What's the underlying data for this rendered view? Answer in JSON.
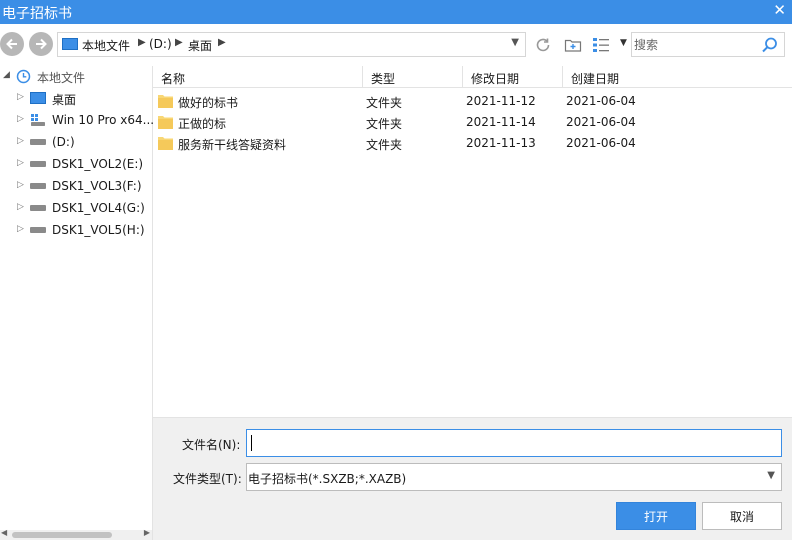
{
  "window": {
    "title": "电子招标书"
  },
  "address": {
    "segments": [
      "本地文件",
      "(D:)",
      "桌面"
    ]
  },
  "search": {
    "placeholder": "搜索"
  },
  "sidebar": {
    "root": "本地文件",
    "items": [
      {
        "label": "桌面",
        "icon": "desktop-icon"
      },
      {
        "label": "Win 10 Pro x64...",
        "icon": "windows-drive-icon"
      },
      {
        "label": "(D:)",
        "icon": "drive-icon"
      },
      {
        "label": "DSK1_VOL2(E:)",
        "icon": "drive-icon"
      },
      {
        "label": "DSK1_VOL3(F:)",
        "icon": "drive-icon"
      },
      {
        "label": "DSK1_VOL4(G:)",
        "icon": "drive-icon"
      },
      {
        "label": "DSK1_VOL5(H:)",
        "icon": "drive-icon"
      }
    ]
  },
  "columns": {
    "name": "名称",
    "type": "类型",
    "modified": "修改日期",
    "created": "创建日期"
  },
  "files": [
    {
      "name": "做好的标书",
      "type": "文件夹",
      "modified": "2021-11-12",
      "created": "2021-06-04"
    },
    {
      "name": "正做的标",
      "type": "文件夹",
      "modified": "2021-11-14",
      "created": "2021-06-04"
    },
    {
      "name": "服务新干线答疑资料",
      "type": "文件夹",
      "modified": "2021-11-13",
      "created": "2021-06-04"
    }
  ],
  "form": {
    "filename_label": "文件名(N):",
    "filename_value": "",
    "filetype_label": "文件类型(T):",
    "filetype_value": "电子招标书(*.SXZB;*.XAZB)"
  },
  "buttons": {
    "open": "打开",
    "cancel": "取消"
  },
  "colors": {
    "accent": "#3b8ee6",
    "folder": "#f8d775"
  }
}
